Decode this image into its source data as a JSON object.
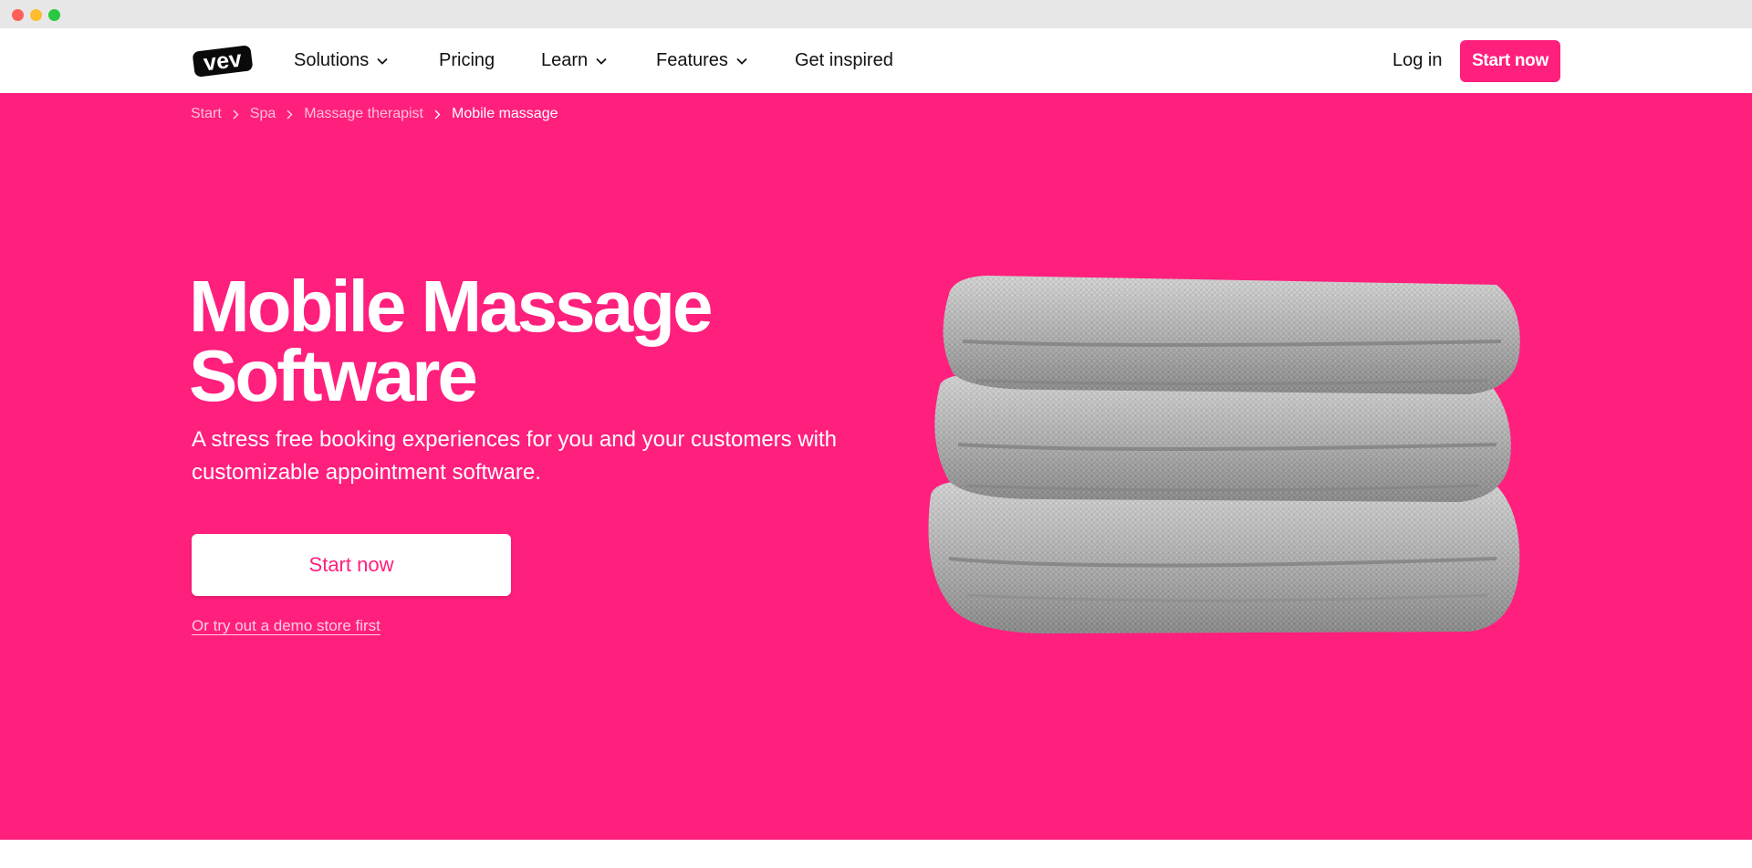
{
  "brand": {
    "logo_text": "vev",
    "accent_color": "#ff1f7d"
  },
  "nav": {
    "items": [
      {
        "label": "Solutions",
        "has_dropdown": true
      },
      {
        "label": "Pricing",
        "has_dropdown": false
      },
      {
        "label": "Learn",
        "has_dropdown": true
      },
      {
        "label": "Features",
        "has_dropdown": true
      },
      {
        "label": "Get inspired",
        "has_dropdown": false
      }
    ],
    "login_label": "Log in",
    "cta_label": "Start now"
  },
  "breadcrumb": {
    "items": [
      "Start",
      "Spa",
      "Massage therapist"
    ],
    "current": "Mobile massage",
    "separator_icon": "chevron-right-icon"
  },
  "hero": {
    "title_line1": "Mobile Massage",
    "title_line2": "Software",
    "subtitle": "A stress free booking experiences for you and your customers with customizable appointment software.",
    "cta_label": "Start now",
    "demo_link": "Or try out a demo store first",
    "image_icon": "folded-towels-image"
  }
}
